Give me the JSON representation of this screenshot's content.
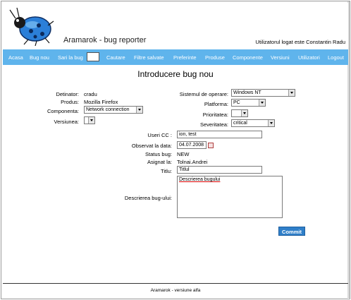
{
  "header": {
    "app_title": "Aramarok - bug reporter",
    "user_info": "Utilizatorul logat este Constantin Radu"
  },
  "nav": {
    "items": [
      "Acasa",
      "Bug nou",
      "Sari la bug",
      "Cautare",
      "Filtre salvate",
      "Preferinte",
      "Produse",
      "Componente",
      "Versiuni",
      "Utilizatori",
      "Logout"
    ],
    "search_value": ""
  },
  "page_title": "Introducere bug nou",
  "form": {
    "detinator_label": "Detinator:",
    "detinator_value": "cradu",
    "produs_label": "Produs:",
    "produs_value": "Mozilla Firefox",
    "componenta_label": "Componenta:",
    "componenta_value": "Network connection",
    "versiunea_label": "Versiunea:",
    "versiunea_value": "",
    "sistem_label": "Sistemul de operare:",
    "sistem_value": "Windows NT",
    "platforma_label": "Platforma:",
    "platforma_value": "PC",
    "prioritatea_label": "Prioritatea:",
    "prioritatea_value": "",
    "severitatea_label": "Severitatea:",
    "severitatea_value": "critical",
    "useri_cc_label": "Useri CC :",
    "useri_cc_value": "ion, test",
    "observat_label": "Observat la data:",
    "observat_value": "04.07.2008",
    "status_label": "Status bug:",
    "status_value": "NEW",
    "asignat_label": "Asignat la:",
    "asignat_value": "Tolnai.Andrei",
    "titlu_label": "Titlu:",
    "titlu_value": "Titlul",
    "descriere_label": "Descrierea bug-ului:",
    "descriere_value": "Descrierea bugului",
    "commit_label": "Commit"
  },
  "footer": "Aramarok - versiune alfa",
  "colors": {
    "navbar": "#5fb4ec",
    "commit_button": "#2f7fc9",
    "logo_bug": "#2b7fd8"
  }
}
